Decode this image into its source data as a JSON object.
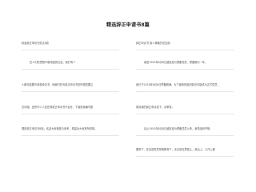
{
  "title": "精选辞正申请书8篇",
  "left_column": [
    "精选辞正申请书范文8篇",
    "在人们的思想不断增强的社会，我们有个",
    "人都可能要写到各种请书，而我们在写辞正申请书的时候需要注",
    "意问题。还有不少人还在得辞正申请书不会写，下面是我编写整",
    "理的辞正申请书8篇，欢迎大家借鉴与参考，希望对大家有所帮助。"
  ],
  "right_column": [
    "辞正申请书 篇1      尊敬的党支部：",
    "我是1955年8月8日被批准为预备党员，预备期为一年，",
    "我已于2016年8月8日预备期满。为了使我的组织能尽可能成为正式党员，",
    "现将我的辞正申请如下，请审查。",
    "自从1955年8月8日被批准为预备党员以来，我党组织严格",
    "要求下，在支部党员帮助教育下，无论是在思想上，政治上，工作上都"
  ]
}
